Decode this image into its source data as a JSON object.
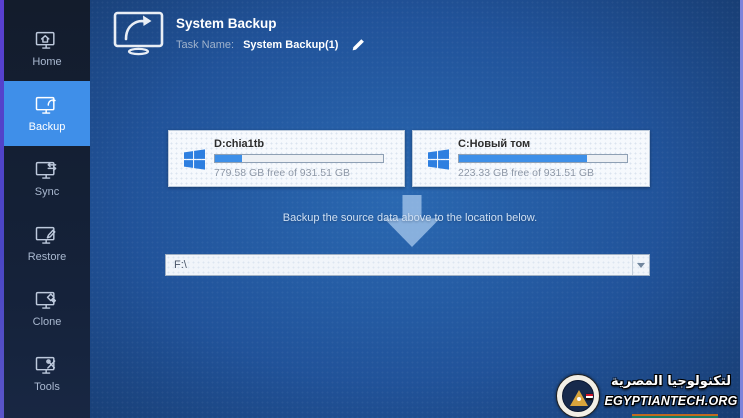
{
  "header": {
    "title": "System Backup",
    "task_name_label": "Task Name:",
    "task_name_value": "System Backup(1)"
  },
  "sidebar": {
    "active_color": "#3f8fe9",
    "items": [
      {
        "label": "Home",
        "icon": "home-monitor-icon",
        "active": false
      },
      {
        "label": "Backup",
        "icon": "backup-monitor-icon",
        "active": true
      },
      {
        "label": "Sync",
        "icon": "sync-monitor-icon",
        "active": false
      },
      {
        "label": "Restore",
        "icon": "restore-monitor-icon",
        "active": false
      },
      {
        "label": "Clone",
        "icon": "clone-monitor-icon",
        "active": false
      },
      {
        "label": "Tools",
        "icon": "tools-monitor-icon",
        "active": false
      }
    ]
  },
  "sources": [
    {
      "name": "D:chia1tb",
      "free_text": "779.58 GB free of 931.51 GB",
      "used_percent": 16
    },
    {
      "name": "C:Новый том",
      "free_text": "223.33 GB free of 931.51 GB",
      "used_percent": 76
    }
  ],
  "hint_text": "Backup the source data above to the location below.",
  "destination": {
    "value": "F:\\"
  },
  "watermark": {
    "arabic": "لتكنولوجيا المصرية",
    "site": "EGYPTIANTECH.ORG"
  },
  "colors": {
    "progress_fill": "#3d8fe8",
    "windows_logo": "#2e7fe0",
    "arrow": "#adcdf0"
  }
}
